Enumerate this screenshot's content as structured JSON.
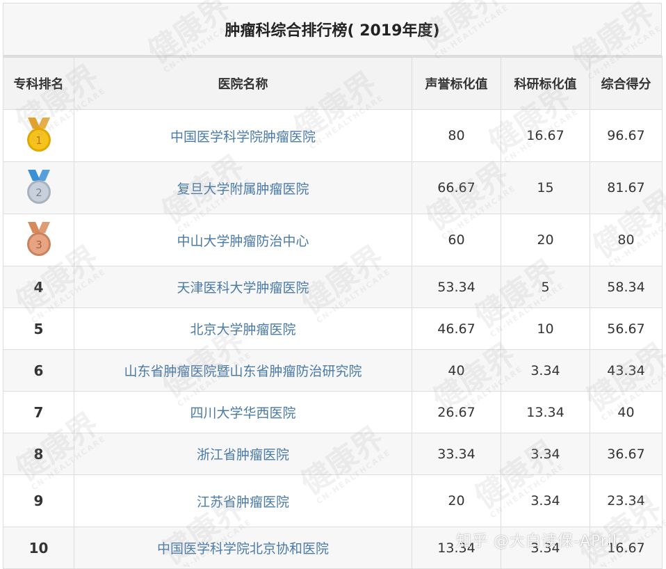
{
  "title": "肿瘤科综合排行榜( 2019年度)",
  "headers": [
    "专科排名",
    "医院名称",
    "声誉标化值",
    "科研标化值",
    "综合得分"
  ],
  "rows": [
    {
      "rank": "1",
      "medal": "gold",
      "hospital": "中国医学科学院肿瘤医院",
      "reputation": "80",
      "research": "16.67",
      "total": "96.67"
    },
    {
      "rank": "2",
      "medal": "silver",
      "hospital": "复旦大学附属肿瘤医院",
      "reputation": "66.67",
      "research": "15",
      "total": "81.67"
    },
    {
      "rank": "3",
      "medal": "bronze",
      "hospital": "中山大学肿瘤防治中心",
      "reputation": "60",
      "research": "20",
      "total": "80"
    },
    {
      "rank": "4",
      "hospital": "天津医科大学肿瘤医院",
      "reputation": "53.34",
      "research": "5",
      "total": "58.34"
    },
    {
      "rank": "5",
      "hospital": "北京大学肿瘤医院",
      "reputation": "46.67",
      "research": "10",
      "total": "56.67"
    },
    {
      "rank": "6",
      "hospital": "山东省肿瘤医院暨山东省肿瘤防治研究院",
      "reputation": "40",
      "research": "3.34",
      "total": "43.34"
    },
    {
      "rank": "7",
      "hospital": "四川大学华西医院",
      "reputation": "26.67",
      "research": "13.34",
      "total": "40"
    },
    {
      "rank": "8",
      "hospital": "浙江省肿瘤医院",
      "reputation": "33.34",
      "research": "3.34",
      "total": "36.67"
    },
    {
      "rank": "9",
      "hospital": "江苏省肿瘤医院",
      "reputation": "20",
      "research": "3.34",
      "total": "23.34"
    },
    {
      "rank": "10",
      "hospital": "中国医学科学院北京协和医院",
      "reputation": "13.34",
      "research": "3.34",
      "total": "16.67"
    }
  ],
  "medal_colors": {
    "gold": {
      "ribbon": "#e8a020",
      "disc": "#f6c21c",
      "rim": "#e0a800",
      "text": "#c07800"
    },
    "silver": {
      "ribbon": "#3b8fd6",
      "disc": "#c8d0dc",
      "rim": "#a7b2c0",
      "text": "#7a8696"
    },
    "bronze": {
      "ribbon": "#d98a5a",
      "disc": "#e6a482",
      "rim": "#c9825e",
      "text": "#a85f3c"
    }
  },
  "watermark": {
    "text": "健康界",
    "sub": "CN-HEALTHCARE"
  },
  "footer_watermark": "知乎 @大白读保-APril"
}
